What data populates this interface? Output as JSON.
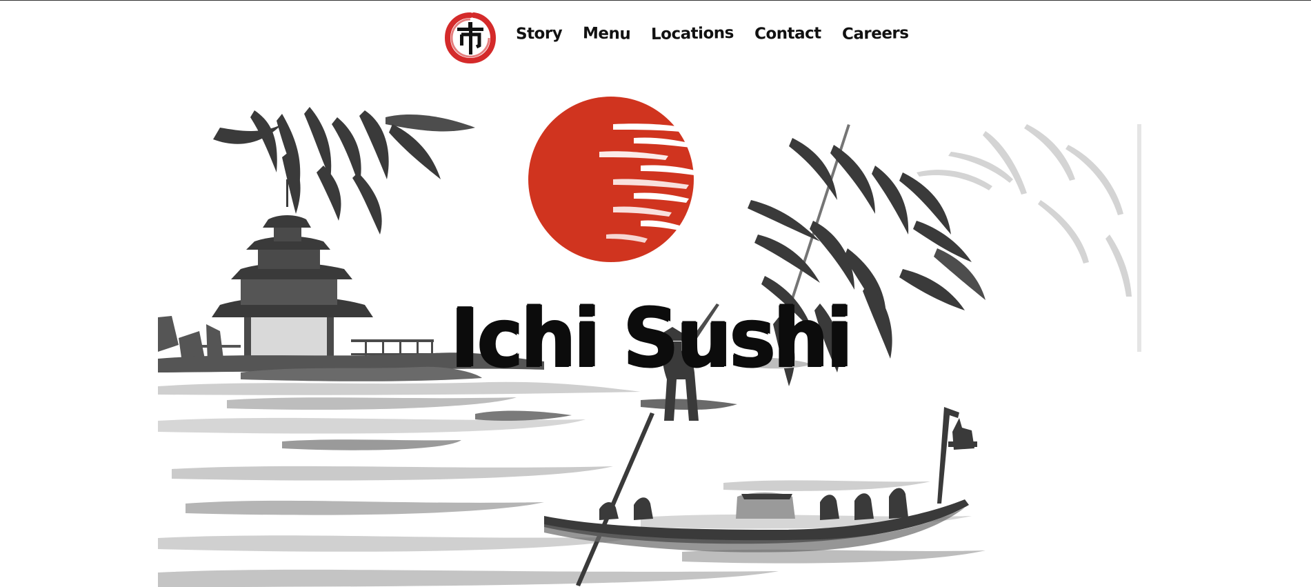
{
  "nav": {
    "logo_icon": "ichi-kanji-enso-logo-icon",
    "items": [
      {
        "label": "Story"
      },
      {
        "label": "Menu"
      },
      {
        "label": "Locations"
      },
      {
        "label": "Contact"
      },
      {
        "label": "Careers"
      }
    ]
  },
  "hero": {
    "title": "Ichi Sushi",
    "illustration": "sumi-e-landscape-illustration",
    "colors": {
      "sun": "#d0341f",
      "ink": "#3a3a3a",
      "ink_light": "#bdbdbd",
      "logo_red": "#d42a2a"
    }
  }
}
